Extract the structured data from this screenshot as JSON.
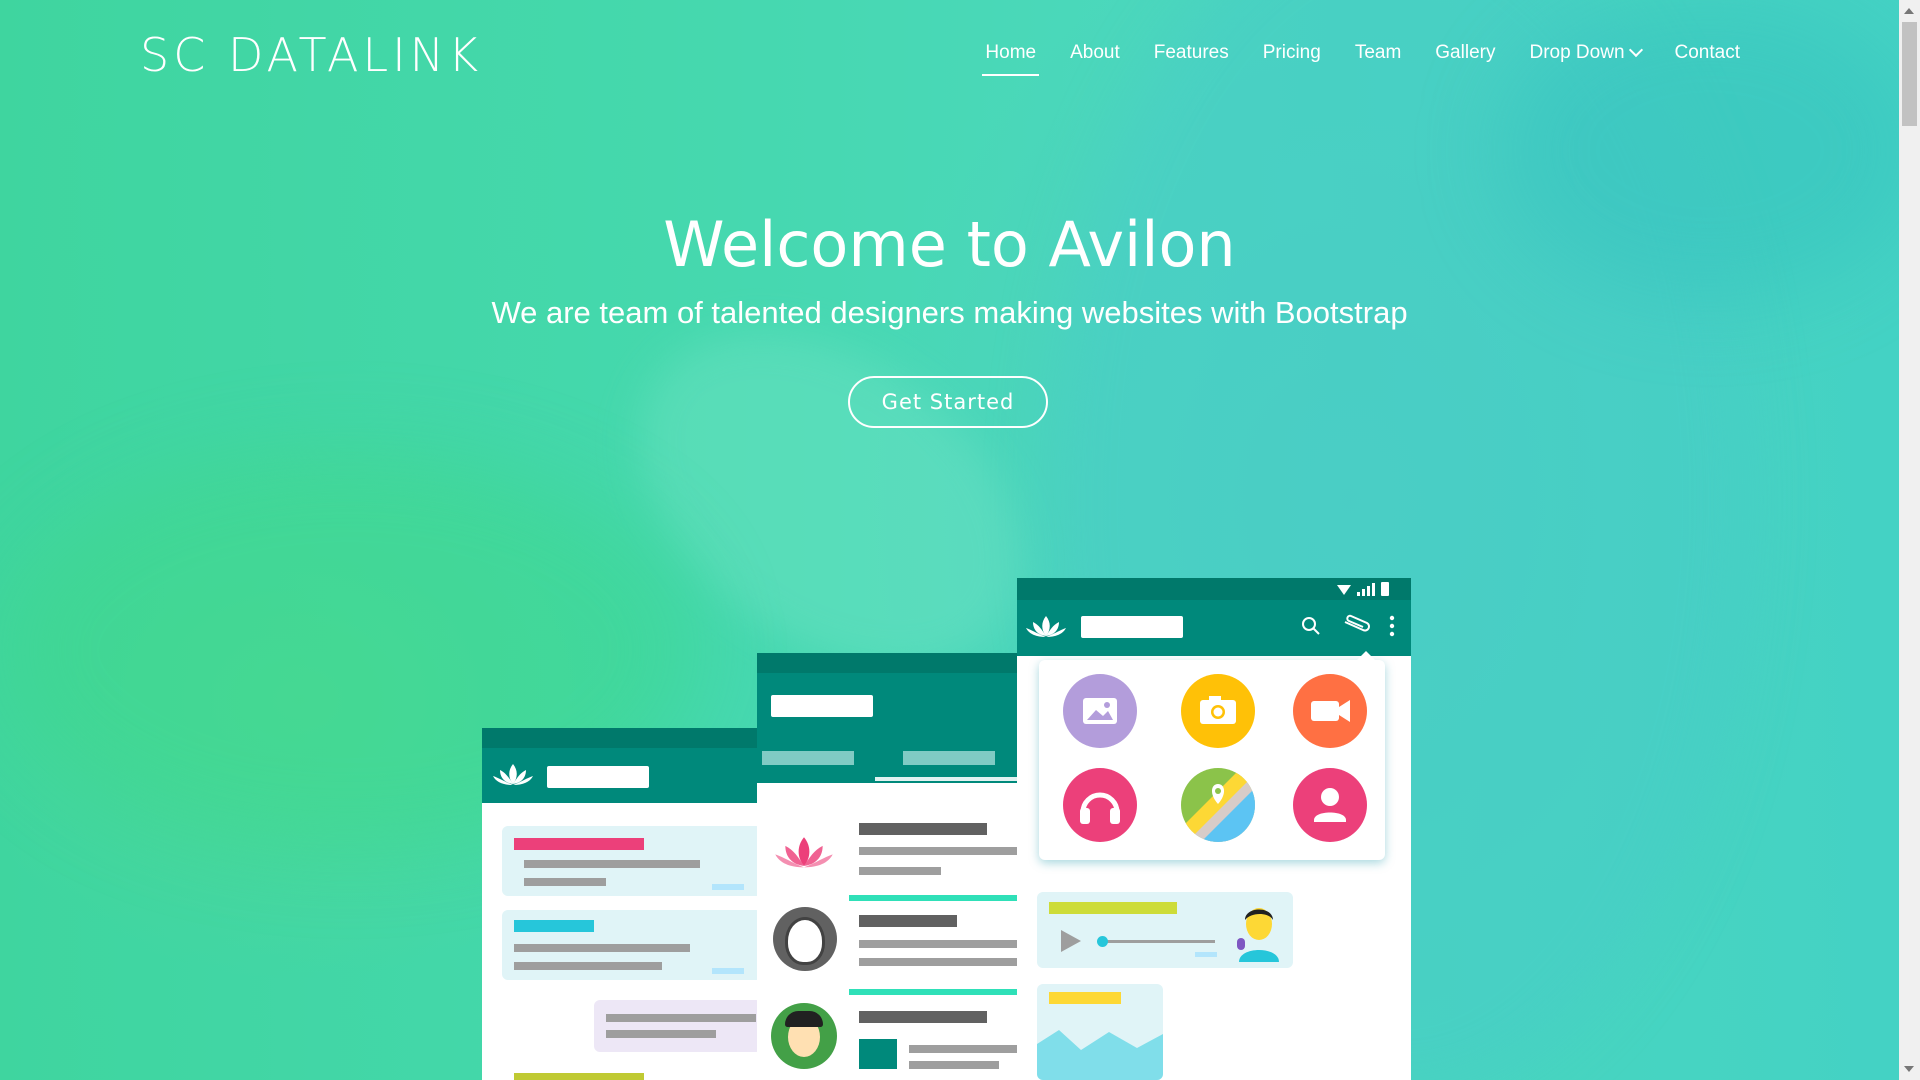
{
  "brand": {
    "logo": "SC DATALINK"
  },
  "nav": {
    "items": [
      {
        "label": "Home",
        "active": true
      },
      {
        "label": "About"
      },
      {
        "label": "Features"
      },
      {
        "label": "Pricing"
      },
      {
        "label": "Team"
      },
      {
        "label": "Gallery"
      },
      {
        "label": "Drop Down",
        "has_dropdown": true
      },
      {
        "label": "Contact"
      }
    ]
  },
  "hero": {
    "title": "Welcome to Avilon",
    "subtitle": "We are team of talented designers making websites with Bootstrap",
    "cta_label": "Get Started"
  },
  "colors": {
    "teal_dark": "#00796b",
    "teal_mid": "#00897b",
    "accent_pink": "#ec407a",
    "accent_cyan": "#26c6da",
    "accent_yellow": "#fdd835",
    "hero_green": "#45d8ad"
  },
  "illustration": {
    "icons": [
      "lotus-icon",
      "search-icon",
      "paperclip-icon",
      "more-vert-icon",
      "image-icon",
      "camera-icon",
      "video-icon",
      "headphones-icon",
      "map-icon",
      "person-icon",
      "play-icon",
      "mic-icon"
    ]
  }
}
